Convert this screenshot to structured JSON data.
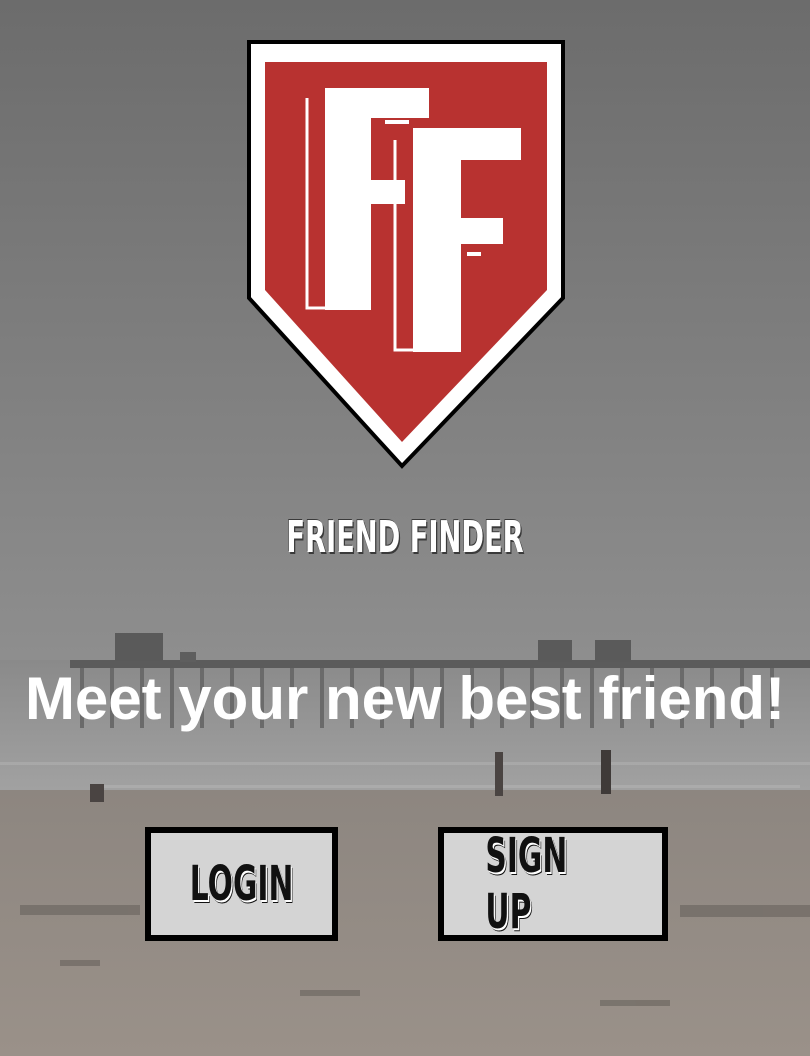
{
  "app": {
    "logo_letters": "FF",
    "brand_name": "FRIEND FINDER",
    "tagline": "Meet your new best friend!"
  },
  "actions": {
    "login_label": "LOGIN",
    "signup_label": "SIGN UP"
  },
  "colors": {
    "shield_red": "#b83230",
    "shield_border": "#000000",
    "button_bg": "#d4d4d4",
    "button_border": "#000000",
    "text_white": "#ffffff"
  },
  "icons": {
    "logo": "ff-shield-logo",
    "background": "beach-pier-photo"
  }
}
